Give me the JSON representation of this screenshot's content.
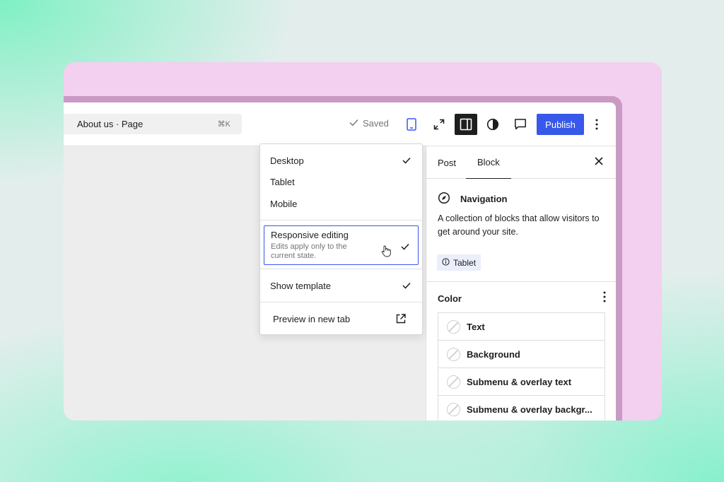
{
  "topbar": {
    "document_title": "About us · Page",
    "shortcut": "⌘K",
    "saved_label": "Saved",
    "publish_label": "Publish"
  },
  "menu": {
    "items": [
      {
        "label": "Desktop",
        "checked": true
      },
      {
        "label": "Tablet",
        "checked": false
      },
      {
        "label": "Mobile",
        "checked": false
      }
    ],
    "responsive": {
      "label": "Responsive editing",
      "description": "Edits apply only to the current state.",
      "checked": true
    },
    "show_template": {
      "label": "Show template",
      "checked": true
    },
    "preview": {
      "label": "Preview in new tab"
    }
  },
  "sidebar": {
    "tabs": [
      "Post",
      "Block"
    ],
    "active_tab": "Block",
    "block": {
      "name": "Navigation",
      "description": "A collection of blocks that allow visitors to get around your site.",
      "badge": "Tablet"
    },
    "color": {
      "label": "Color",
      "items": [
        "Text",
        "Background",
        "Submenu & overlay text",
        "Submenu & overlay backgr..."
      ]
    }
  },
  "colors": {
    "accent": "#3858e9",
    "card": "#f3cff0",
    "badge_bg": "#ebeefb"
  }
}
